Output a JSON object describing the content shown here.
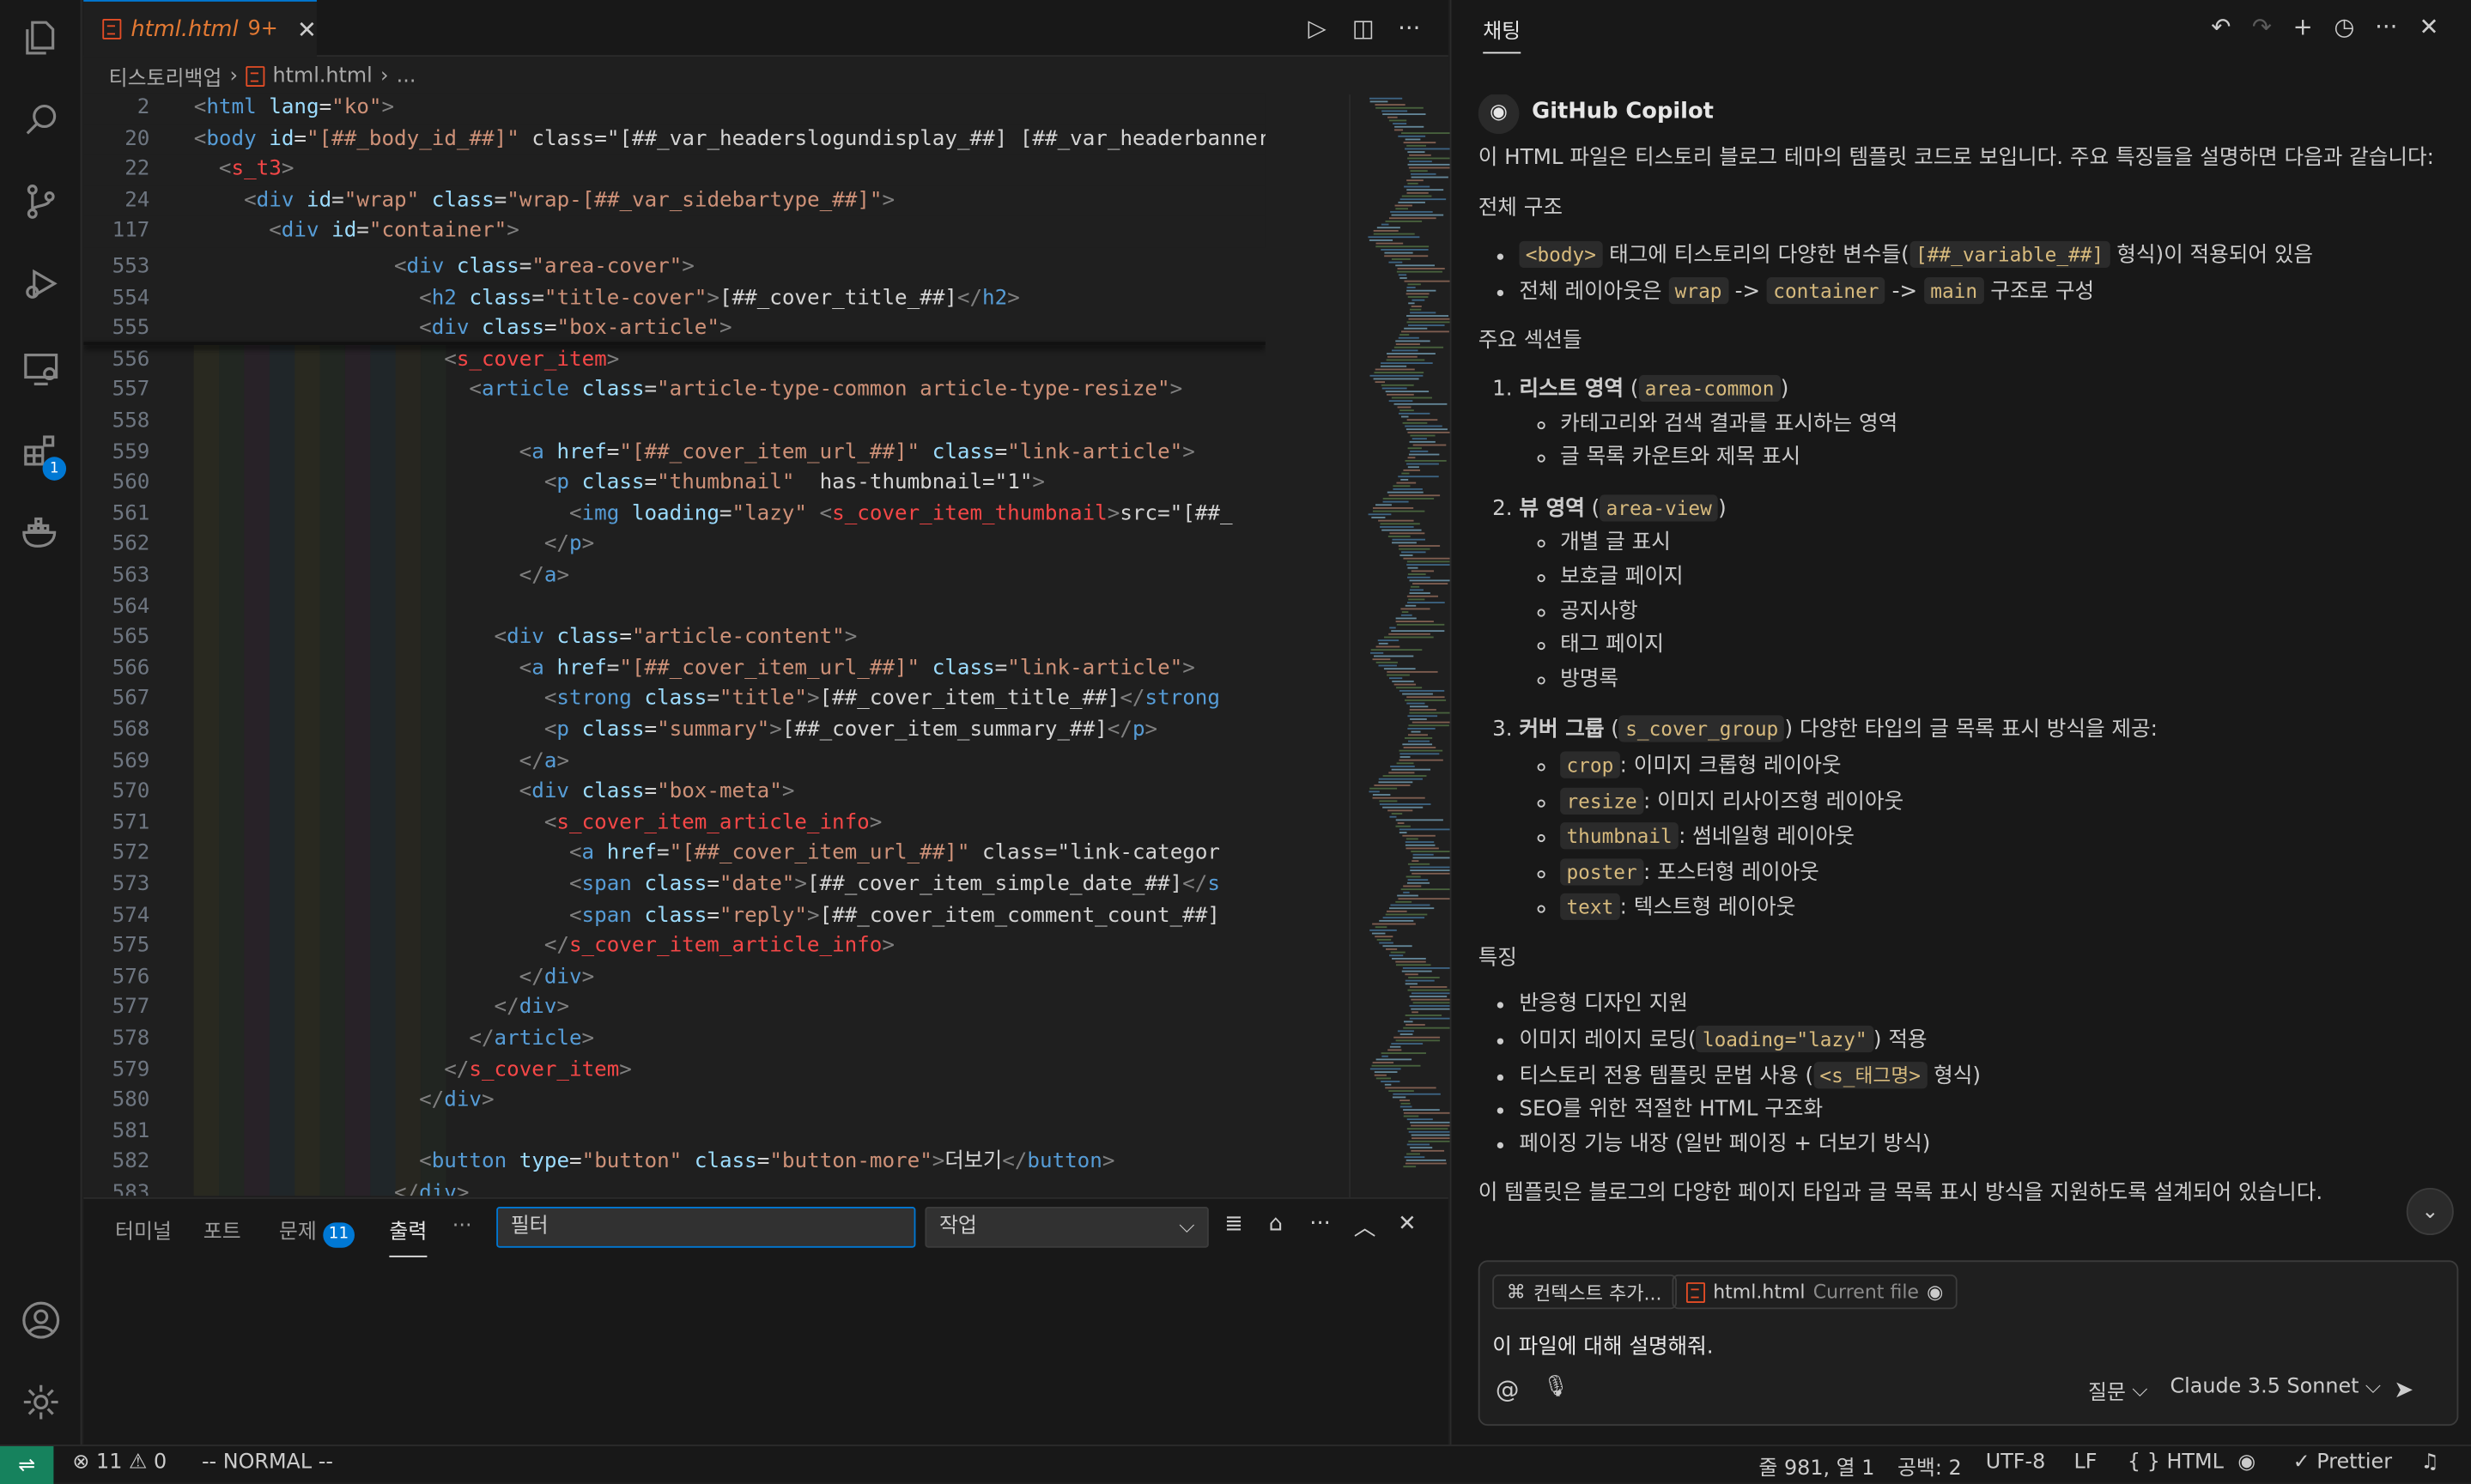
{
  "editor": {
    "tab": {
      "filename": "html.html",
      "problem_count": "9+"
    },
    "breadcrumb": [
      "티스토리백업",
      "html.html",
      "..."
    ],
    "sticky": [
      {
        "ln": "2",
        "code": "<html lang=\"ko\">"
      },
      {
        "ln": "20",
        "code": "<body id=\"[##_body_id_##]\" class=\"[##_var_headerslogundisplay_##] [##_var_headerbanner"
      },
      {
        "ln": "22",
        "code": "  <s_t3>"
      },
      {
        "ln": "24",
        "code": "    <div id=\"wrap\" class=\"wrap-[##_var_sidebartype_##]\">"
      },
      {
        "ln": "117",
        "code": "      <div id=\"container\">"
      }
    ],
    "lines": [
      {
        "ln": "553",
        "code": "                <div class=\"area-cover\">"
      },
      {
        "ln": "554",
        "code": "                  <h2 class=\"title-cover\">[##_cover_title_##]</h2>"
      },
      {
        "ln": "555",
        "code": "                  <div class=\"box-article\">"
      },
      {
        "ln": "556",
        "code": "                    <s_cover_item>"
      },
      {
        "ln": "557",
        "code": "                      <article class=\"article-type-common article-type-resize\">"
      },
      {
        "ln": "558",
        "code": ""
      },
      {
        "ln": "559",
        "code": "                          <a href=\"[##_cover_item_url_##]\" class=\"link-article\">"
      },
      {
        "ln": "560",
        "code": "                            <p class=\"thumbnail\"  has-thumbnail=\"1\">"
      },
      {
        "ln": "561",
        "code": "                              <img loading=\"lazy\" <s_cover_item_thumbnail>src=\"[##_"
      },
      {
        "ln": "562",
        "code": "                            </p>"
      },
      {
        "ln": "563",
        "code": "                          </a>"
      },
      {
        "ln": "564",
        "code": ""
      },
      {
        "ln": "565",
        "code": "                        <div class=\"article-content\">"
      },
      {
        "ln": "566",
        "code": "                          <a href=\"[##_cover_item_url_##]\" class=\"link-article\">"
      },
      {
        "ln": "567",
        "code": "                            <strong class=\"title\">[##_cover_item_title_##]</strong"
      },
      {
        "ln": "568",
        "code": "                            <p class=\"summary\">[##_cover_item_summary_##]</p>"
      },
      {
        "ln": "569",
        "code": "                          </a>"
      },
      {
        "ln": "570",
        "code": "                          <div class=\"box-meta\">"
      },
      {
        "ln": "571",
        "code": "                            <s_cover_item_article_info>"
      },
      {
        "ln": "572",
        "code": "                              <a href=\"[##_cover_item_url_##]\" class=\"link-categor"
      },
      {
        "ln": "573",
        "code": "                              <span class=\"date\">[##_cover_item_simple_date_##]</s"
      },
      {
        "ln": "574",
        "code": "                              <span class=\"reply\">[##_cover_item_comment_count_##]"
      },
      {
        "ln": "575",
        "code": "                            </s_cover_item_article_info>"
      },
      {
        "ln": "576",
        "code": "                          </div>"
      },
      {
        "ln": "577",
        "code": "                        </div>"
      },
      {
        "ln": "578",
        "code": "                      </article>"
      },
      {
        "ln": "579",
        "code": "                    </s_cover_item>"
      },
      {
        "ln": "580",
        "code": "                  </div>"
      },
      {
        "ln": "581",
        "code": ""
      },
      {
        "ln": "582",
        "code": "                  <button type=\"button\" class=\"button-more\">더보기</button>"
      },
      {
        "ln": "583",
        "code": "                </div>"
      }
    ]
  },
  "panel": {
    "tabs": [
      "터미널",
      "포트",
      "문제",
      "출력"
    ],
    "problem_badge": "11",
    "more": "···",
    "filter_placeholder": "필터",
    "channel": "작업"
  },
  "chat": {
    "title": "채팅",
    "author": "GitHub Copilot",
    "intro": "이 HTML 파일은 티스토리 블로그 테마의 템플릿 코드로 보입니다. 주요 특징들을 설명하면 다음과 같습니다:",
    "h_structure": "전체 구조",
    "s1_a": "<body>",
    "s1_b": " 태그에 티스토리의 다양한 변수들(",
    "s1_c": "[##_variable_##]",
    "s1_d": " 형식)이 적용되어 있음",
    "s2_a": "전체 레이아웃은 ",
    "s2_b": "wrap",
    "s2_c": " -> ",
    "s2_d": "container",
    "s2_e": " -> ",
    "s2_f": "main",
    "s2_g": " 구조로 구성",
    "h_sections": "주요 섹션들",
    "sec1_title": "리스트 영역",
    "sec1_code": "area-common",
    "sec1_items": [
      "카테고리와 검색 결과를 표시하는 영역",
      "글 목록 카운트와 제목 표시"
    ],
    "sec2_title": "뷰 영역",
    "sec2_code": "area-view",
    "sec2_items": [
      "개별 글 표시",
      "보호글 페이지",
      "공지사항",
      "태그 페이지",
      "방명록"
    ],
    "sec3_title": "커버 그룹",
    "sec3_code": "s_cover_group",
    "sec3_desc": " 다양한 타입의 글 목록 표시 방식을 제공:",
    "sec3_items": [
      {
        "code": "crop",
        "text": ": 이미지 크롭형 레이아웃"
      },
      {
        "code": "resize",
        "text": ": 이미지 리사이즈형 레이아웃"
      },
      {
        "code": "thumbnail",
        "text": ": 썸네일형 레이아웃"
      },
      {
        "code": "poster",
        "text": ": 포스터형 레이아웃"
      },
      {
        "code": "text",
        "text": ": 텍스트형 레이아웃"
      }
    ],
    "h_features": "특징",
    "f1": "반응형 디자인 지원",
    "f2_a": "이미지 레이지 로딩(",
    "f2_b": "loading=\"lazy\"",
    "f2_c": ") 적용",
    "f3_a": "티스토리 전용 템플릿 문법 사용 (",
    "f3_b": "<s_태그명>",
    "f3_c": " 형식)",
    "f4": "SEO를 위한 적절한 HTML 구조화",
    "f5": "페이징 기능 내장 (일반 페이징 + 더보기 방식)",
    "outro": "이 템플릿은 블로그의 다양한 페이지 타입과 글 목록 표시 방식을 지원하도록 설계되어 있습니다.",
    "add_context": "컨텍스트 추가...",
    "file_chip": "html.html",
    "file_chip_note": "Current file",
    "prompt": "이 파일에 대해 설명해줘.",
    "mode": "질문",
    "model": "Claude 3.5 Sonnet"
  },
  "status": {
    "errors": "11",
    "warnings": "0",
    "mode": "-- NORMAL --",
    "position": "줄 981, 열 1",
    "spaces": "공백: 2",
    "encoding": "UTF-8",
    "eol": "LF",
    "language": "HTML",
    "formatter": "Prettier"
  },
  "activity_badge": "1"
}
